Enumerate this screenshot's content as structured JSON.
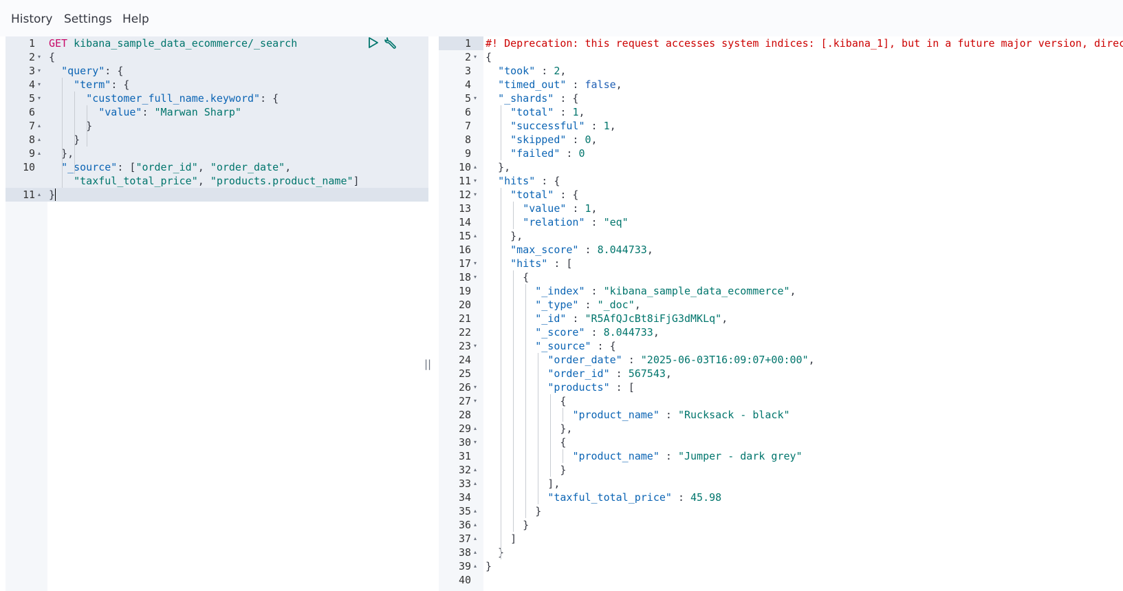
{
  "menu": {
    "history": "History",
    "settings": "Settings",
    "help": "Help"
  },
  "request": {
    "lines": [
      [
        [
          "method",
          "GET"
        ],
        [
          "punc",
          " "
        ],
        [
          "url",
          "kibana_sample_data_ecommerce/_search"
        ]
      ],
      [
        [
          "punc",
          "{"
        ]
      ],
      [
        [
          "punc",
          "  "
        ],
        [
          "key",
          "\"query\""
        ],
        [
          "punc",
          ": {"
        ]
      ],
      [
        [
          "punc",
          "    "
        ],
        [
          "key",
          "\"term\""
        ],
        [
          "punc",
          ": {"
        ]
      ],
      [
        [
          "punc",
          "      "
        ],
        [
          "key",
          "\"customer_full_name.keyword\""
        ],
        [
          "punc",
          ": {"
        ]
      ],
      [
        [
          "punc",
          "        "
        ],
        [
          "key",
          "\"value\""
        ],
        [
          "punc",
          ": "
        ],
        [
          "str",
          "\"Marwan Sharp\""
        ]
      ],
      [
        [
          "punc",
          "      }"
        ]
      ],
      [
        [
          "punc",
          "    }"
        ]
      ],
      [
        [
          "punc",
          "  },"
        ]
      ],
      [
        [
          "punc",
          "  "
        ],
        [
          "key",
          "\"_source\""
        ],
        [
          "punc",
          ": ["
        ],
        [
          "str",
          "\"order_id\""
        ],
        [
          "punc",
          ", "
        ],
        [
          "str",
          "\"order_date\""
        ],
        [
          "punc",
          ","
        ]
      ],
      [
        [
          "punc",
          "    "
        ],
        [
          "str",
          "\"taxful_total_price\""
        ],
        [
          "punc",
          ", "
        ],
        [
          "str",
          "\"products.product_name\""
        ],
        [
          "punc",
          "]"
        ]
      ],
      [
        [
          "punc",
          "}"
        ]
      ]
    ],
    "numbers": [
      "1",
      "2",
      "3",
      "4",
      "5",
      "6",
      "7",
      "8",
      "9",
      "10",
      "",
      "11"
    ],
    "folds": [
      "",
      "open",
      "open",
      "open",
      "open",
      "",
      "close",
      "close",
      "close",
      "",
      "",
      "close"
    ]
  },
  "response": {
    "lines": [
      [
        [
          "warn",
          "#! Deprecation: this request accesses system indices: [.kibana_1], but in a future major version, direct access to system indices will be prevented by default"
        ]
      ],
      [
        [
          "punc",
          "{"
        ]
      ],
      [
        [
          "punc",
          "  "
        ],
        [
          "key",
          "\"took\""
        ],
        [
          "punc",
          " : "
        ],
        [
          "num-v",
          "2"
        ],
        [
          "punc",
          ","
        ]
      ],
      [
        [
          "punc",
          "  "
        ],
        [
          "key",
          "\"timed_out\""
        ],
        [
          "punc",
          " : "
        ],
        [
          "bool",
          "false"
        ],
        [
          "punc",
          ","
        ]
      ],
      [
        [
          "punc",
          "  "
        ],
        [
          "key",
          "\"_shards\""
        ],
        [
          "punc",
          " : {"
        ]
      ],
      [
        [
          "punc",
          "    "
        ],
        [
          "key",
          "\"total\""
        ],
        [
          "punc",
          " : "
        ],
        [
          "num-v",
          "1"
        ],
        [
          "punc",
          ","
        ]
      ],
      [
        [
          "punc",
          "    "
        ],
        [
          "key",
          "\"successful\""
        ],
        [
          "punc",
          " : "
        ],
        [
          "num-v",
          "1"
        ],
        [
          "punc",
          ","
        ]
      ],
      [
        [
          "punc",
          "    "
        ],
        [
          "key",
          "\"skipped\""
        ],
        [
          "punc",
          " : "
        ],
        [
          "num-v",
          "0"
        ],
        [
          "punc",
          ","
        ]
      ],
      [
        [
          "punc",
          "    "
        ],
        [
          "key",
          "\"failed\""
        ],
        [
          "punc",
          " : "
        ],
        [
          "num-v",
          "0"
        ]
      ],
      [
        [
          "punc",
          "  },"
        ]
      ],
      [
        [
          "punc",
          "  "
        ],
        [
          "key",
          "\"hits\""
        ],
        [
          "punc",
          " : {"
        ]
      ],
      [
        [
          "punc",
          "    "
        ],
        [
          "key",
          "\"total\""
        ],
        [
          "punc",
          " : {"
        ]
      ],
      [
        [
          "punc",
          "      "
        ],
        [
          "key",
          "\"value\""
        ],
        [
          "punc",
          " : "
        ],
        [
          "num-v",
          "1"
        ],
        [
          "punc",
          ","
        ]
      ],
      [
        [
          "punc",
          "      "
        ],
        [
          "key",
          "\"relation\""
        ],
        [
          "punc",
          " : "
        ],
        [
          "str",
          "\"eq\""
        ]
      ],
      [
        [
          "punc",
          "    },"
        ]
      ],
      [
        [
          "punc",
          "    "
        ],
        [
          "key",
          "\"max_score\""
        ],
        [
          "punc",
          " : "
        ],
        [
          "num-v",
          "8.044733"
        ],
        [
          "punc",
          ","
        ]
      ],
      [
        [
          "punc",
          "    "
        ],
        [
          "key",
          "\"hits\""
        ],
        [
          "punc",
          " : ["
        ]
      ],
      [
        [
          "punc",
          "      {"
        ]
      ],
      [
        [
          "punc",
          "        "
        ],
        [
          "key",
          "\"_index\""
        ],
        [
          "punc",
          " : "
        ],
        [
          "str",
          "\"kibana_sample_data_ecommerce\""
        ],
        [
          "punc",
          ","
        ]
      ],
      [
        [
          "punc",
          "        "
        ],
        [
          "key",
          "\"_type\""
        ],
        [
          "punc",
          " : "
        ],
        [
          "str",
          "\"_doc\""
        ],
        [
          "punc",
          ","
        ]
      ],
      [
        [
          "punc",
          "        "
        ],
        [
          "key",
          "\"_id\""
        ],
        [
          "punc",
          " : "
        ],
        [
          "str",
          "\"R5AfQJcBt8iFjG3dMKLq\""
        ],
        [
          "punc",
          ","
        ]
      ],
      [
        [
          "punc",
          "        "
        ],
        [
          "key",
          "\"_score\""
        ],
        [
          "punc",
          " : "
        ],
        [
          "num-v",
          "8.044733"
        ],
        [
          "punc",
          ","
        ]
      ],
      [
        [
          "punc",
          "        "
        ],
        [
          "key",
          "\"_source\""
        ],
        [
          "punc",
          " : {"
        ]
      ],
      [
        [
          "punc",
          "          "
        ],
        [
          "key",
          "\"order_date\""
        ],
        [
          "punc",
          " : "
        ],
        [
          "str",
          "\"2025-06-03T16:09:07+00:00\""
        ],
        [
          "punc",
          ","
        ]
      ],
      [
        [
          "punc",
          "          "
        ],
        [
          "key",
          "\"order_id\""
        ],
        [
          "punc",
          " : "
        ],
        [
          "num-v",
          "567543"
        ],
        [
          "punc",
          ","
        ]
      ],
      [
        [
          "punc",
          "          "
        ],
        [
          "key",
          "\"products\""
        ],
        [
          "punc",
          " : ["
        ]
      ],
      [
        [
          "punc",
          "            {"
        ]
      ],
      [
        [
          "punc",
          "              "
        ],
        [
          "key",
          "\"product_name\""
        ],
        [
          "punc",
          " : "
        ],
        [
          "str",
          "\"Rucksack - black\""
        ]
      ],
      [
        [
          "punc",
          "            },"
        ]
      ],
      [
        [
          "punc",
          "            {"
        ]
      ],
      [
        [
          "punc",
          "              "
        ],
        [
          "key",
          "\"product_name\""
        ],
        [
          "punc",
          " : "
        ],
        [
          "str",
          "\"Jumper - dark grey\""
        ]
      ],
      [
        [
          "punc",
          "            }"
        ]
      ],
      [
        [
          "punc",
          "          ],"
        ]
      ],
      [
        [
          "punc",
          "          "
        ],
        [
          "key",
          "\"taxful_total_price\""
        ],
        [
          "punc",
          " : "
        ],
        [
          "num-v",
          "45.98"
        ]
      ],
      [
        [
          "punc",
          "        }"
        ]
      ],
      [
        [
          "punc",
          "      }"
        ]
      ],
      [
        [
          "punc",
          "    ]"
        ]
      ],
      [
        [
          "punc",
          "  }"
        ]
      ],
      [
        [
          "punc",
          "}"
        ]
      ],
      []
    ],
    "folds": [
      "",
      "open",
      "",
      "",
      "open",
      "",
      "",
      "",
      "",
      "close",
      "open",
      "open",
      "",
      "",
      "close",
      "",
      "open",
      "open",
      "",
      "",
      "",
      "",
      "open",
      "",
      "",
      "open",
      "open",
      "",
      "close",
      "open",
      "",
      "close",
      "close",
      "",
      "close",
      "close",
      "close",
      "close",
      "close",
      ""
    ]
  },
  "icons": {
    "run": "play-icon",
    "wrench": "wrench-icon",
    "splitter": "drag-handle-icon"
  },
  "splitter_glyph": "||"
}
